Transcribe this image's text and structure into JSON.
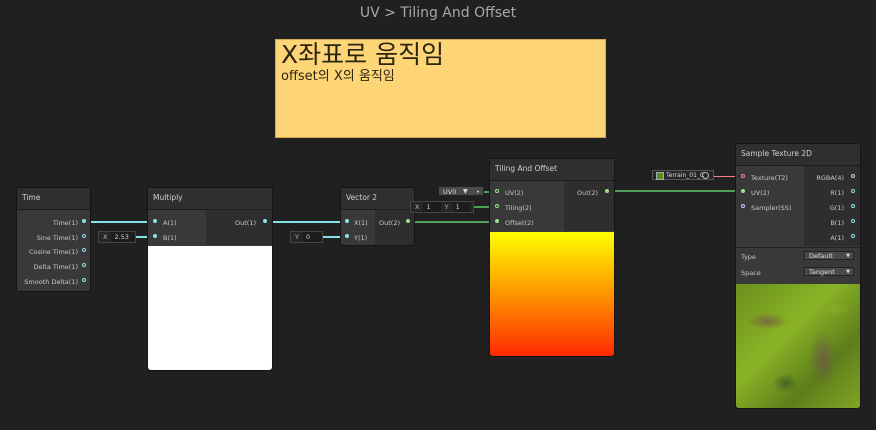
{
  "window": {
    "breadcrumb": "UV > Tiling And Offset"
  },
  "sticky_note": {
    "title": "X좌표로 움직임",
    "body": "offset의 X의 움직임",
    "color": "#fdd476"
  },
  "colors": {
    "wire_float": "#84e4e7",
    "wire_vec2": "#4fa15a"
  },
  "nodes": {
    "time": {
      "title": "Time",
      "outputs": [
        "Time(1)",
        "Sine Time(1)",
        "Cosine Time(1)",
        "Delta Time(1)",
        "Smooth Delta(1)"
      ]
    },
    "multiply": {
      "title": "Multiply",
      "inputs": [
        "A(1)",
        "B(1)"
      ],
      "output": "Out(1)",
      "b_field": {
        "label": "X",
        "value": "2.53"
      }
    },
    "vector2": {
      "title": "Vector 2",
      "inputs": [
        "X(1)",
        "Y(1)"
      ],
      "output": "Out(2)",
      "y_field": {
        "label": "Y",
        "value": "0"
      }
    },
    "tiling": {
      "title": "Tiling And Offset",
      "inputs": [
        "UV(2)",
        "Tiling(2)",
        "Offset(2)"
      ],
      "output": "Out(2)",
      "uv_field": "UV0",
      "tiling_field": {
        "x_label": "X",
        "x_value": "1",
        "y_label": "Y",
        "y_value": "1"
      }
    },
    "sample": {
      "title": "Sample Texture 2D",
      "inputs": [
        "Texture(T2)",
        "UV(2)",
        "Sampler(SS)"
      ],
      "outputs": [
        "RGBA(4)",
        "R(1)",
        "G(1)",
        "B(1)",
        "A(1)"
      ],
      "texture_field": "Terrain_01_C",
      "type_label": "Type",
      "type_value": "Default",
      "space_label": "Space",
      "space_value": "Tangent"
    }
  },
  "icons": {
    "dropdown": "chevron-down-icon",
    "target": "target-icon"
  }
}
